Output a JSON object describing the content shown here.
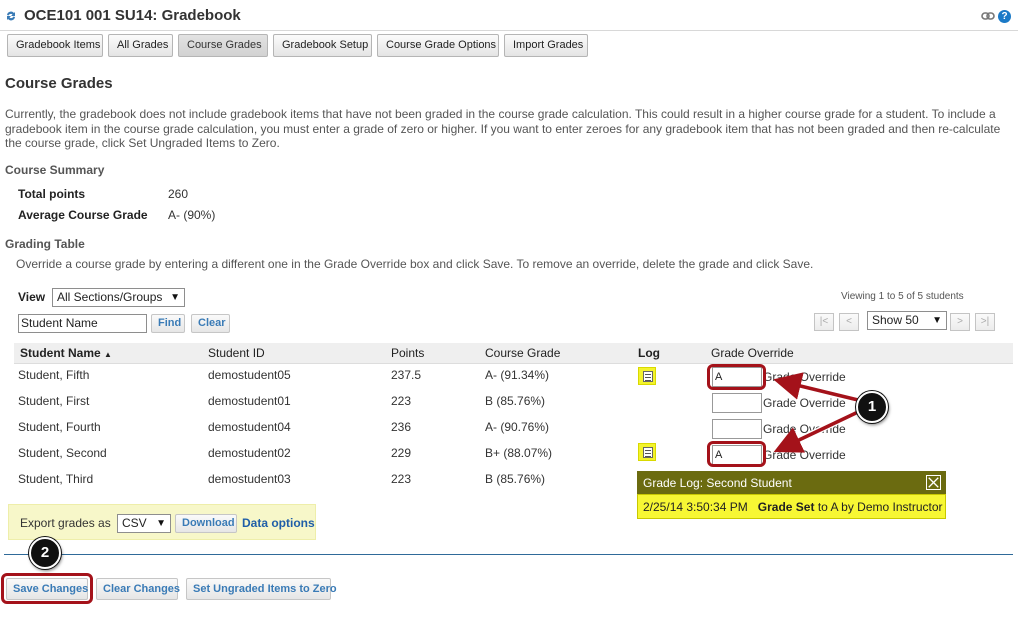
{
  "window": {
    "title": "OCE101 001 SU14: Gradebook",
    "help_glyph": "?"
  },
  "tabs": [
    {
      "label": "Gradebook Items"
    },
    {
      "label": "All Grades"
    },
    {
      "label": "Course Grades"
    },
    {
      "label": "Gradebook Setup"
    },
    {
      "label": "Course Grade Options"
    },
    {
      "label": "Import Grades"
    }
  ],
  "page": {
    "heading": "Course Grades",
    "intro": "Currently, the gradebook does not include gradebook items that have not been graded in the course grade calculation. This could result in a higher course grade for a student. To include a gradebook item in the course grade calculation, you must enter a grade of zero or higher. If you want to enter zeroes for any gradebook item that has not been graded and then re-calculate the course grade, click Set Ungraded Items to Zero."
  },
  "summary": {
    "heading": "Course Summary",
    "total_points_label": "Total points",
    "total_points_value": "260",
    "avg_label": "Average Course Grade",
    "avg_value": "A- (90%)"
  },
  "grading_table": {
    "heading": "Grading Table",
    "description": "Override a course grade by entering a different one in the Grade Override box and click Save. To remove an override, delete the grade and click Save.",
    "view_label": "View",
    "view_selected": "All Sections/Groups",
    "search_value": "Student Name",
    "find_label": "Find",
    "clear_label": "Clear",
    "viewing_text": "Viewing 1 to 5 of 5 students",
    "pager": {
      "first": "|<",
      "prev": "<",
      "show_selected": "Show 50",
      "next": ">",
      "last": ">|"
    },
    "columns": {
      "student_name": "Student Name",
      "sort_glyph": "▲",
      "student_id": "Student ID",
      "points": "Points",
      "course_grade": "Course Grade",
      "log": "Log",
      "grade_override": "Grade Override"
    },
    "override_placeholder": "Grade Override",
    "rows": [
      {
        "name": "Student, Fifth",
        "id": "demostudent05",
        "points": "237.5",
        "grade": "A- (91.34%)",
        "override": "A",
        "has_log": true
      },
      {
        "name": "Student, First",
        "id": "demostudent01",
        "points": "223",
        "grade": "B (85.76%)",
        "override": "",
        "has_log": false
      },
      {
        "name": "Student, Fourth",
        "id": "demostudent04",
        "points": "236",
        "grade": "A- (90.76%)",
        "override": "",
        "has_log": false
      },
      {
        "name": "Student, Second",
        "id": "demostudent02",
        "points": "229",
        "grade": "B+ (88.07%)",
        "override": "A",
        "has_log": true
      },
      {
        "name": "Student, Third",
        "id": "demostudent03",
        "points": "223",
        "grade": "B (85.76%)",
        "override": "",
        "has_log": false
      }
    ]
  },
  "grade_log": {
    "title": "Grade Log: Second Student",
    "timestamp": "2/25/14 3:50:34 PM",
    "action": "Grade Set",
    "detail": "to A by Demo Instructor"
  },
  "export": {
    "label": "Export grades as",
    "format_selected": "CSV",
    "download_label": "Download",
    "data_options_label": "Data options"
  },
  "actions": {
    "save": "Save Changes",
    "clear": "Clear Changes",
    "set_zero": "Set Ungraded Items to Zero"
  },
  "callouts": [
    {
      "number": "1"
    },
    {
      "number": "2"
    }
  ],
  "colors": {
    "callout_highlight": "#a4121a",
    "link_blue": "#1f5ea8",
    "log_yellow": "#f3f32c",
    "log_header": "#6b6b10"
  }
}
